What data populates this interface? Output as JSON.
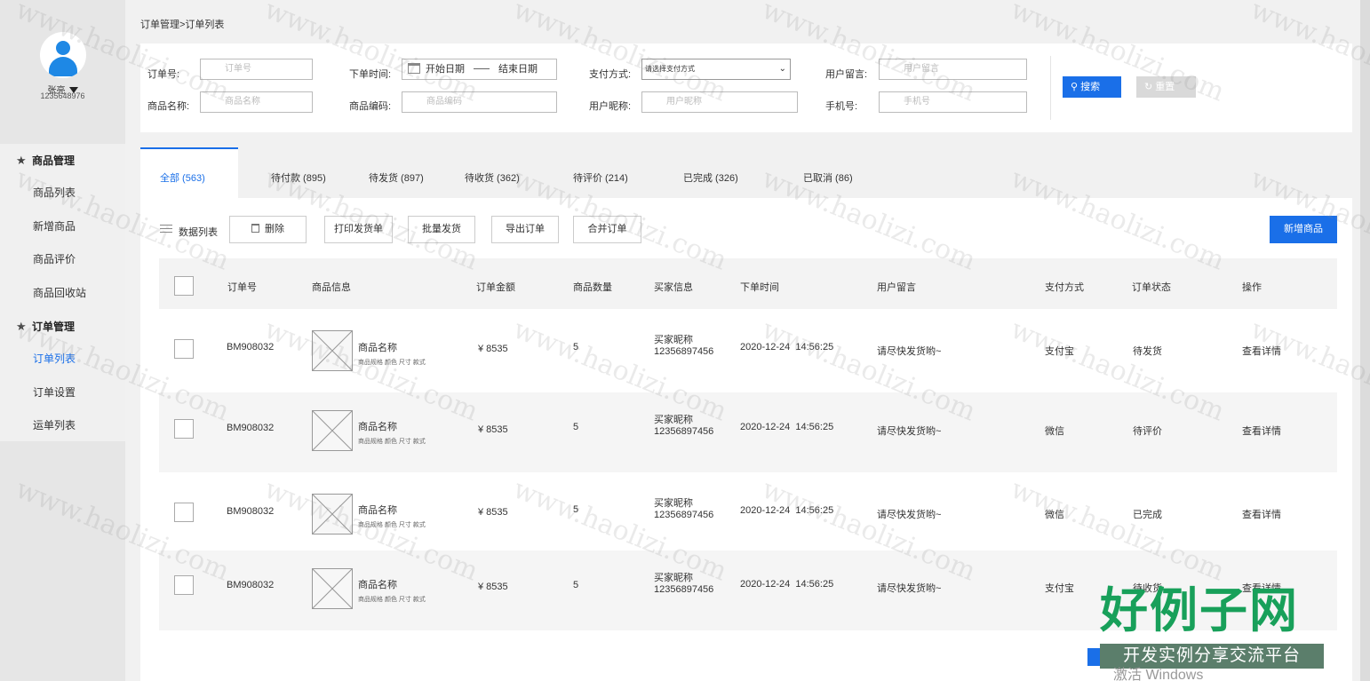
{
  "sidebar": {
    "user_name": "张亮",
    "user_id": "1235648976",
    "groups": [
      {
        "label": "商品管理",
        "items": [
          "商品列表",
          "新增商品",
          "商品评价",
          "商品回收站"
        ]
      },
      {
        "label": "订单管理",
        "items": [
          "订单列表",
          "订单设置",
          "运单列表"
        ]
      }
    ],
    "active_item": "订单列表"
  },
  "breadcrumb": "订单管理>订单列表",
  "search": {
    "order_no_label": "订单号:",
    "order_no_placeholder": "订单号",
    "order_time_label": "下单时间:",
    "start_date": "开始日期",
    "end_date": "结束日期",
    "pay_method_label": "支付方式:",
    "pay_method_value": "请选择支付方式",
    "message_label": "用户留言:",
    "message_placeholder": "用户留言",
    "product_name_label": "商品名称:",
    "product_name_placeholder": "商品名称",
    "product_code_label": "商品编码:",
    "product_code_placeholder": "商品编码",
    "nickname_label": "用户昵称:",
    "nickname_placeholder": "用户昵称",
    "phone_label": "手机号:",
    "phone_placeholder": "手机号",
    "search_button": "搜索",
    "reset_button": "重置"
  },
  "tabs": [
    "全部 (563)",
    "待付款 (895)",
    "待发货 (897)",
    "待收货 (362)",
    "待评价 (214)",
    "已完成 (326)",
    "已取消 (86)"
  ],
  "toolbar": {
    "list_title": "数据列表",
    "delete": "删除",
    "print": "打印发货单",
    "batch_ship": "批量发货",
    "export": "导出订单",
    "merge": "合并订单",
    "add_product": "新增商品"
  },
  "table": {
    "columns": [
      "订单号",
      "商品信息",
      "订单金额",
      "商品数量",
      "买家信息",
      "下单时间",
      "用户留言",
      "支付方式",
      "订单状态",
      "操作"
    ],
    "rows": [
      {
        "order_no": "BM908032",
        "product_name": "商品名称",
        "product_spec": "商品规格 颜色 尺寸 款式",
        "amount": "¥ 8535",
        "quantity": "5",
        "buyer_nick": "买家昵称",
        "buyer_phone": "12356897456",
        "time": "2020-12-24  14:56:25",
        "message": "请尽快发货哟~",
        "pay": "支付宝",
        "status": "待发货",
        "action": "查看详情"
      },
      {
        "order_no": "BM908032",
        "product_name": "商品名称",
        "product_spec": "商品规格 颜色 尺寸 款式",
        "amount": "¥ 8535",
        "quantity": "5",
        "buyer_nick": "买家昵称",
        "buyer_phone": "12356897456",
        "time": "2020-12-24  14:56:25",
        "message": "请尽快发货哟~",
        "pay": "微信",
        "status": "待评价",
        "action": "查看详情"
      },
      {
        "order_no": "BM908032",
        "product_name": "商品名称",
        "product_spec": "商品规格 颜色 尺寸 款式",
        "amount": "¥ 8535",
        "quantity": "5",
        "buyer_nick": "买家昵称",
        "buyer_phone": "12356897456",
        "time": "2020-12-24  14:56:25",
        "message": "请尽快发货哟~",
        "pay": "微信",
        "status": "已完成",
        "action": "查看详情"
      },
      {
        "order_no": "BM908032",
        "product_name": "商品名称",
        "product_spec": "商品规格 颜色 尺寸 款式",
        "amount": "¥ 8535",
        "quantity": "5",
        "buyer_nick": "买家昵称",
        "buyer_phone": "12356897456",
        "time": "2020-12-24  14:56:25",
        "message": "请尽快发货哟~",
        "pay": "支付宝",
        "status": "待收货",
        "action": "查看详情"
      }
    ]
  },
  "watermark": "www.haolizi.com",
  "brand": {
    "title": "好例子网",
    "subtitle": "开发实例分享交流平台"
  },
  "os_notice": "激活 Windows",
  "colors": {
    "accent": "#1a6fe8",
    "sidebar_bg": "#e6e6e6",
    "brand_green": "#18a05a"
  }
}
